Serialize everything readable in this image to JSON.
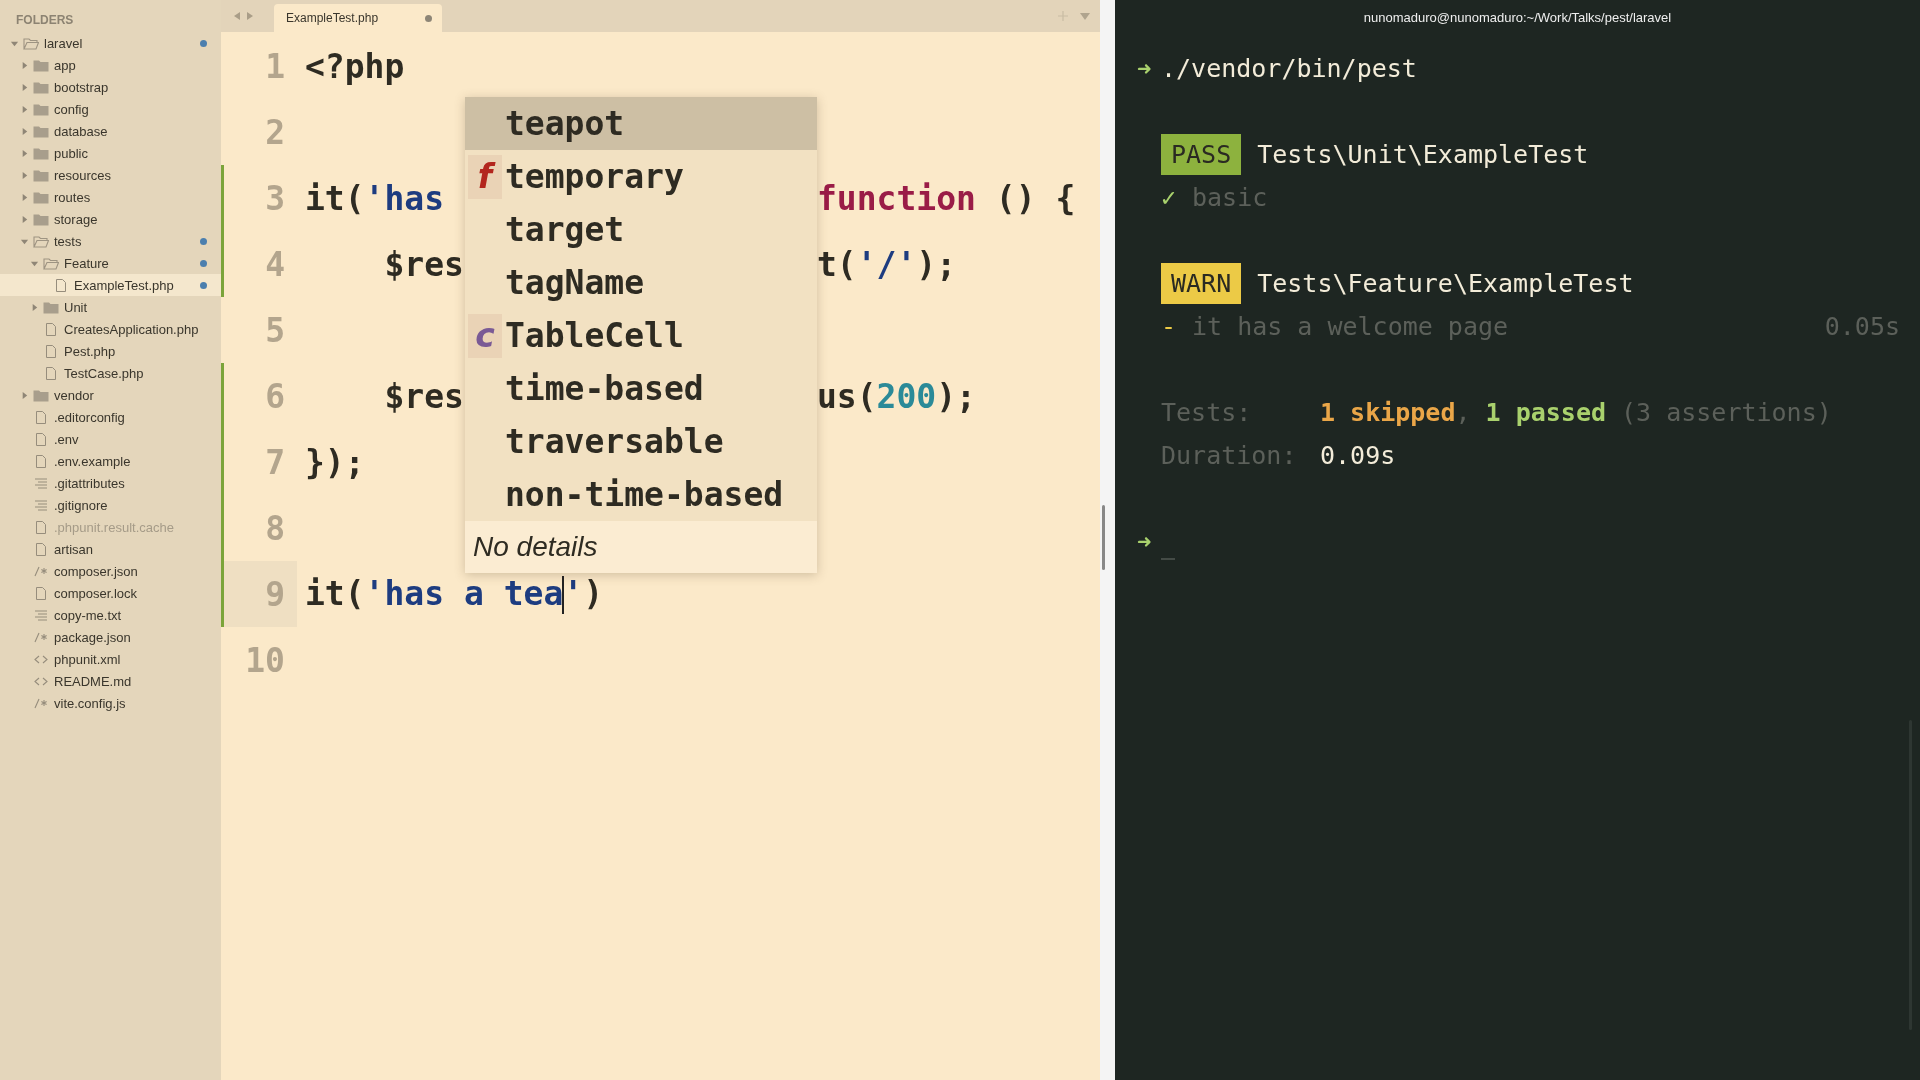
{
  "sidebar": {
    "heading": "FOLDERS",
    "tree": [
      {
        "name": "laravel",
        "kind": "folder",
        "expanded": true,
        "selected": false,
        "modified": true,
        "dimmed": false,
        "children": [
          {
            "name": "app",
            "kind": "folder",
            "expanded": false,
            "selected": false,
            "modified": false,
            "dimmed": false
          },
          {
            "name": "bootstrap",
            "kind": "folder",
            "expanded": false,
            "selected": false,
            "modified": false,
            "dimmed": false
          },
          {
            "name": "config",
            "kind": "folder",
            "expanded": false,
            "selected": false,
            "modified": false,
            "dimmed": false
          },
          {
            "name": "database",
            "kind": "folder",
            "expanded": false,
            "selected": false,
            "modified": false,
            "dimmed": false
          },
          {
            "name": "public",
            "kind": "folder",
            "expanded": false,
            "selected": false,
            "modified": false,
            "dimmed": false
          },
          {
            "name": "resources",
            "kind": "folder",
            "expanded": false,
            "selected": false,
            "modified": false,
            "dimmed": false
          },
          {
            "name": "routes",
            "kind": "folder",
            "expanded": false,
            "selected": false,
            "modified": false,
            "dimmed": false
          },
          {
            "name": "storage",
            "kind": "folder",
            "expanded": false,
            "selected": false,
            "modified": false,
            "dimmed": false
          },
          {
            "name": "tests",
            "kind": "folder",
            "expanded": true,
            "selected": false,
            "modified": true,
            "dimmed": false,
            "children": [
              {
                "name": "Feature",
                "kind": "folder",
                "expanded": true,
                "selected": false,
                "modified": true,
                "dimmed": false,
                "children": [
                  {
                    "name": "ExampleTest.php",
                    "kind": "file",
                    "selected": true,
                    "modified": true,
                    "dimmed": false
                  }
                ]
              },
              {
                "name": "Unit",
                "kind": "folder",
                "expanded": false,
                "selected": false,
                "modified": false,
                "dimmed": false
              },
              {
                "name": "CreatesApplication.php",
                "kind": "file",
                "selected": false,
                "modified": false,
                "dimmed": false
              },
              {
                "name": "Pest.php",
                "kind": "file",
                "selected": false,
                "modified": false,
                "dimmed": false
              },
              {
                "name": "TestCase.php",
                "kind": "file",
                "selected": false,
                "modified": false,
                "dimmed": false
              }
            ]
          },
          {
            "name": "vendor",
            "kind": "folder",
            "expanded": false,
            "selected": false,
            "modified": false,
            "dimmed": false
          },
          {
            "name": ".editorconfig",
            "kind": "file",
            "selected": false,
            "modified": false,
            "dimmed": false
          },
          {
            "name": ".env",
            "kind": "file",
            "selected": false,
            "modified": false,
            "dimmed": false
          },
          {
            "name": ".env.example",
            "kind": "file",
            "selected": false,
            "modified": false,
            "dimmed": false
          },
          {
            "name": ".gitattributes",
            "kind": "text",
            "selected": false,
            "modified": false,
            "dimmed": false
          },
          {
            "name": ".gitignore",
            "kind": "text",
            "selected": false,
            "modified": false,
            "dimmed": false
          },
          {
            "name": ".phpunit.result.cache",
            "kind": "file",
            "selected": false,
            "modified": false,
            "dimmed": true
          },
          {
            "name": "artisan",
            "kind": "file",
            "selected": false,
            "modified": false,
            "dimmed": false
          },
          {
            "name": "composer.json",
            "kind": "script",
            "selected": false,
            "modified": false,
            "dimmed": false
          },
          {
            "name": "composer.lock",
            "kind": "file",
            "selected": false,
            "modified": false,
            "dimmed": false
          },
          {
            "name": "copy-me.txt",
            "kind": "text",
            "selected": false,
            "modified": false,
            "dimmed": false
          },
          {
            "name": "package.json",
            "kind": "script",
            "selected": false,
            "modified": false,
            "dimmed": false
          },
          {
            "name": "phpunit.xml",
            "kind": "markup",
            "selected": false,
            "modified": false,
            "dimmed": false
          },
          {
            "name": "README.md",
            "kind": "markup",
            "selected": false,
            "modified": false,
            "dimmed": false
          },
          {
            "name": "vite.config.js",
            "kind": "script",
            "selected": false,
            "modified": false,
            "dimmed": false
          }
        ]
      }
    ]
  },
  "editor": {
    "tabs": [
      {
        "title": "ExampleTest.php",
        "selected": true,
        "dirty": true
      }
    ],
    "lines": [
      {
        "number": "1",
        "current": false,
        "modified": false,
        "before": [
          {
            "text": "<?php",
            "kind": "plain"
          }
        ]
      },
      {
        "number": "2",
        "current": false,
        "modified": false
      },
      {
        "number": "3",
        "current": false,
        "modified": true,
        "before": [
          {
            "text": "it(",
            "kind": "plain"
          },
          {
            "text": "'has",
            "kind": "string"
          }
        ],
        "after": [
          {
            "text": "function",
            "kind": "keyword"
          },
          {
            "text": " () {",
            "kind": "plain"
          }
        ]
      },
      {
        "number": "4",
        "current": false,
        "modified": true,
        "before": [
          {
            "text": "    $res",
            "kind": "plain"
          }
        ],
        "after": [
          {
            "text": "t(",
            "kind": "plain"
          },
          {
            "text": "'/'",
            "kind": "string"
          },
          {
            "text": ");",
            "kind": "plain"
          }
        ]
      },
      {
        "number": "5",
        "current": false,
        "modified": false
      },
      {
        "number": "6",
        "current": false,
        "modified": true,
        "before": [
          {
            "text": "    $res",
            "kind": "plain"
          }
        ],
        "after": [
          {
            "text": "us(",
            "kind": "plain"
          },
          {
            "text": "200",
            "kind": "number"
          },
          {
            "text": ");",
            "kind": "plain"
          }
        ]
      },
      {
        "number": "7",
        "current": false,
        "modified": true,
        "before": [
          {
            "text": "});",
            "kind": "plain"
          }
        ]
      },
      {
        "number": "8",
        "current": false,
        "modified": true
      },
      {
        "number": "9",
        "current": true,
        "modified": true,
        "before": [
          {
            "text": "it(",
            "kind": "plain"
          },
          {
            "text": "'has a tea",
            "kind": "string"
          },
          {
            "kind": "caret"
          },
          {
            "text": "'",
            "kind": "string"
          },
          {
            "text": ")",
            "kind": "plain"
          }
        ]
      },
      {
        "number": "10",
        "current": false,
        "modified": false
      }
    ],
    "completion": {
      "items": [
        {
          "label": "teapot",
          "selected": true,
          "kind": "none"
        },
        {
          "label": "temporary",
          "selected": false,
          "kind": "function",
          "badge": "f"
        },
        {
          "label": "target",
          "selected": false,
          "kind": "none"
        },
        {
          "label": "tagName",
          "selected": false,
          "kind": "none"
        },
        {
          "label": "TableCell",
          "selected": false,
          "kind": "class",
          "badge": "c"
        },
        {
          "label": "time-based",
          "selected": false,
          "kind": "none"
        },
        {
          "label": "traversable",
          "selected": false,
          "kind": "none"
        },
        {
          "label": "non-time-based",
          "selected": false,
          "kind": "none"
        }
      ],
      "details": "No details"
    }
  },
  "terminal": {
    "title": "nunomaduro@nunomaduro:~/Work/Talks/pest/laravel",
    "prompt": "➜",
    "command": "./vendor/bin/pest",
    "groups": [
      {
        "status": "PASS",
        "kind": "pass",
        "name": "Tests\\Unit\\ExampleTest",
        "tests": [
          {
            "mark": "✓",
            "kind": "pass",
            "name": "basic"
          }
        ]
      },
      {
        "status": "WARN",
        "kind": "warn",
        "name": "Tests\\Feature\\ExampleTest",
        "tests": [
          {
            "mark": "-",
            "kind": "warn",
            "name": "it has a welcome page",
            "time": "0.05s"
          }
        ]
      }
    ],
    "summary": [
      {
        "label": "Tests:",
        "parts": [
          {
            "text": "1 skipped",
            "kind": "skipped"
          },
          {
            "text": ", ",
            "kind": "dim"
          },
          {
            "text": "1 passed",
            "kind": "passed"
          },
          {
            "text": " (3 assertions)",
            "kind": "dim"
          }
        ]
      },
      {
        "label": "Duration:",
        "parts": [
          {
            "text": "0.09s",
            "kind": "bright"
          }
        ]
      }
    ],
    "next_prompt": "➜"
  }
}
